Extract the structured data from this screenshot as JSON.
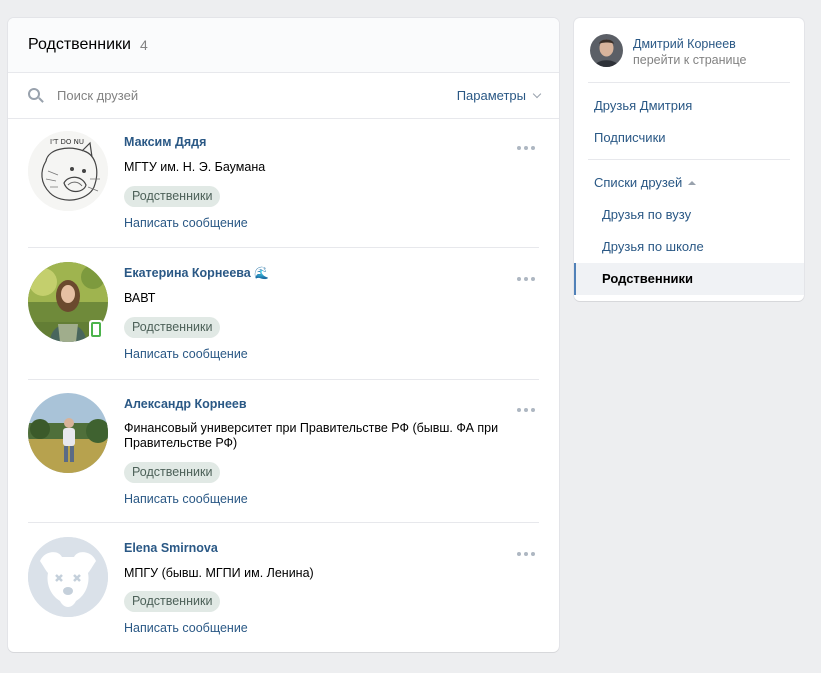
{
  "main": {
    "title": "Родственники",
    "count": "4",
    "search_placeholder": "Поиск друзей",
    "params_label": "Параметры"
  },
  "friends": [
    {
      "name": "Максим Дядя",
      "info": "МГТУ им. Н. Э. Баумана",
      "badge": "Родственники",
      "message": "Написать сообщение",
      "avatar": "sketch-avatar"
    },
    {
      "name": "Екатерина Корнеева",
      "info": "ВАВТ",
      "badge": "Родственники",
      "message": "Написать сообщение",
      "avatar": "photo-avatar",
      "emoji": "🌊",
      "online_mobile": true
    },
    {
      "name": "Александр Корнеев",
      "info": "Финансовый университет при Правительстве РФ (бывш. ФА при Правительстве РФ)",
      "badge": "Родственники",
      "message": "Написать сообщение",
      "avatar": "photo-avatar"
    },
    {
      "name": "Elena Smirnova",
      "info": "МПГУ (бывш. МГПИ им. Ленина)",
      "badge": "Родственники",
      "message": "Написать сообщение",
      "avatar": "deactivated-dog-avatar"
    }
  ],
  "sidebar": {
    "user_name": "Дмитрий Корнеев",
    "user_sub": "перейти к странице",
    "links": [
      "Друзья Дмитрия",
      "Подписчики"
    ],
    "lists_label": "Списки друзей",
    "lists": [
      "Друзья по вузу",
      "Друзья по школе",
      "Родственники"
    ]
  },
  "colors": {
    "link": "#2a5885",
    "badge_bg": "#e1e9e5",
    "active_border": "#5181b8",
    "online": "#4bb34b"
  }
}
